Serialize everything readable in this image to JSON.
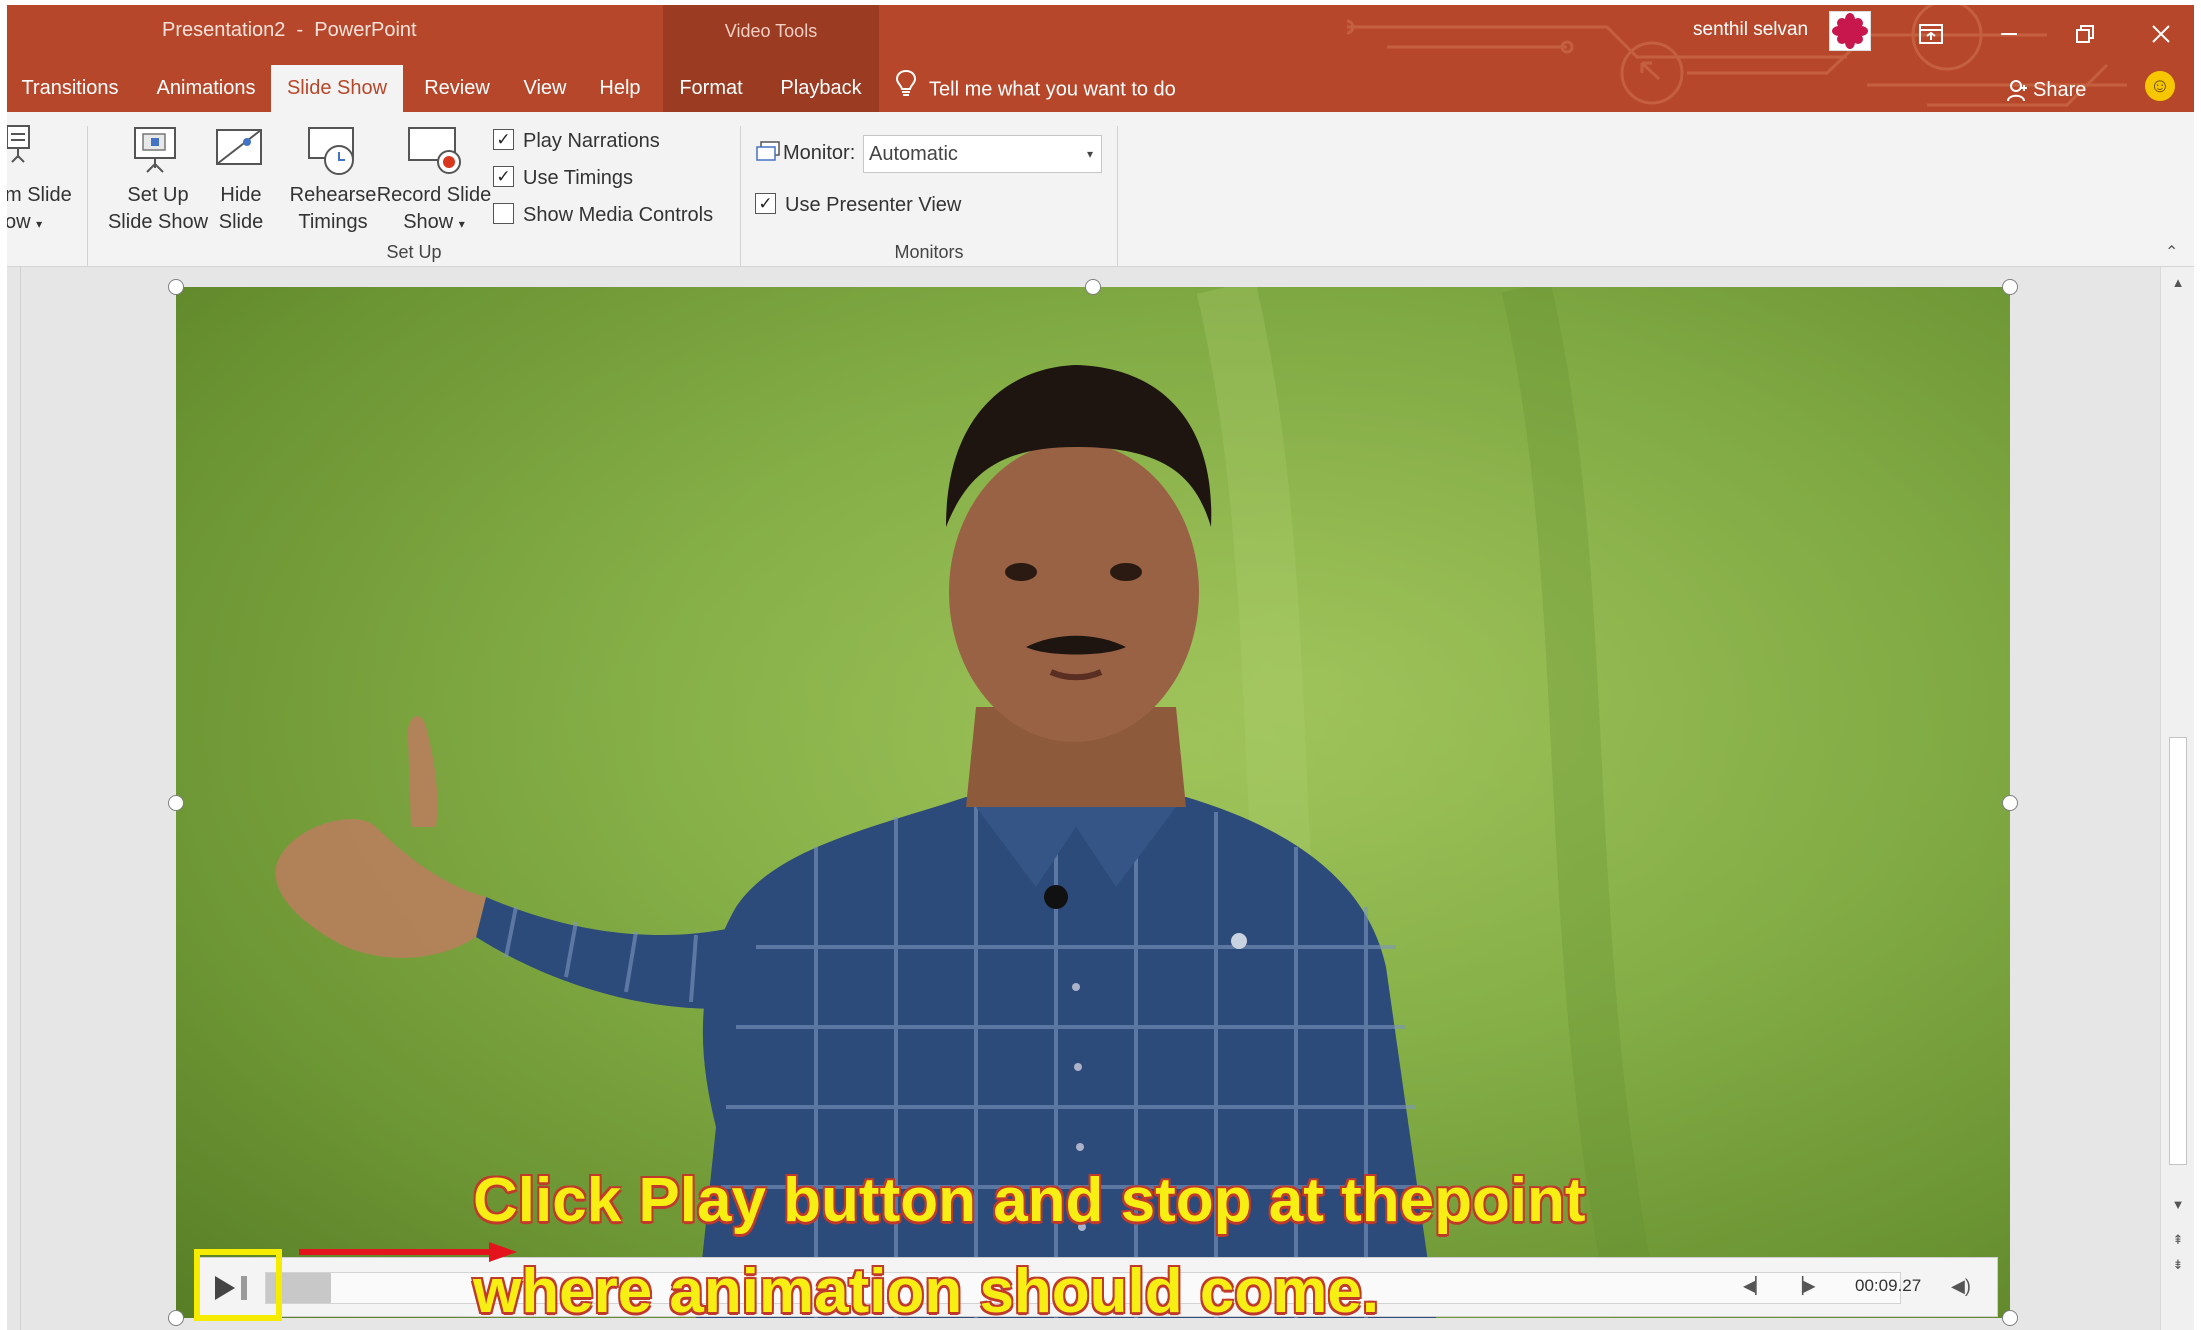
{
  "window": {
    "title": "Presentation2  -  PowerPoint",
    "context_group": "Video Tools",
    "user_name": "senthil selvan",
    "accent": "#b7472a"
  },
  "tabs": [
    {
      "label": "Transitions",
      "active": false
    },
    {
      "label": "Animations",
      "active": false
    },
    {
      "label": "Slide Show",
      "active": true
    },
    {
      "label": "Review",
      "active": false
    },
    {
      "label": "View",
      "active": false
    },
    {
      "label": "Help",
      "active": false
    },
    {
      "label": "Format",
      "active": false
    },
    {
      "label": "Playback",
      "active": false
    }
  ],
  "tell_me": "Tell me what you want to do",
  "share": "Share",
  "ribbon": {
    "custom_slide_show": {
      "line1": "m Slide",
      "line2": "ow"
    },
    "set_up_slide_show": {
      "line1": "Set Up",
      "line2": "Slide Show"
    },
    "hide_slide": {
      "line1": "Hide",
      "line2": "Slide"
    },
    "rehearse_timings": {
      "line1": "Rehearse",
      "line2": "Timings"
    },
    "record_slide_show": {
      "line1": "Record Slide",
      "line2": "Show"
    },
    "play_narrations": {
      "label": "Play Narrations",
      "checked": true
    },
    "use_timings": {
      "label": "Use Timings",
      "checked": true
    },
    "show_media_controls": {
      "label": "Show Media Controls",
      "checked": false
    },
    "set_up_group": "Set Up",
    "monitor_label": "Monitor:",
    "monitor_value": "Automatic",
    "use_presenter_view": {
      "label": "Use Presenter View",
      "checked": true
    },
    "monitors_group": "Monitors"
  },
  "media": {
    "time": "00:09.27",
    "progress": 0.04
  },
  "caption": {
    "line1": "Click Play button and stop at thepoint",
    "line2": "where animation should come."
  },
  "icons": {
    "tell_me": "lightbulb-icon",
    "share": "person-icon",
    "feedback": "smiley-icon",
    "play": "play-icon",
    "volume": "volume-icon"
  }
}
